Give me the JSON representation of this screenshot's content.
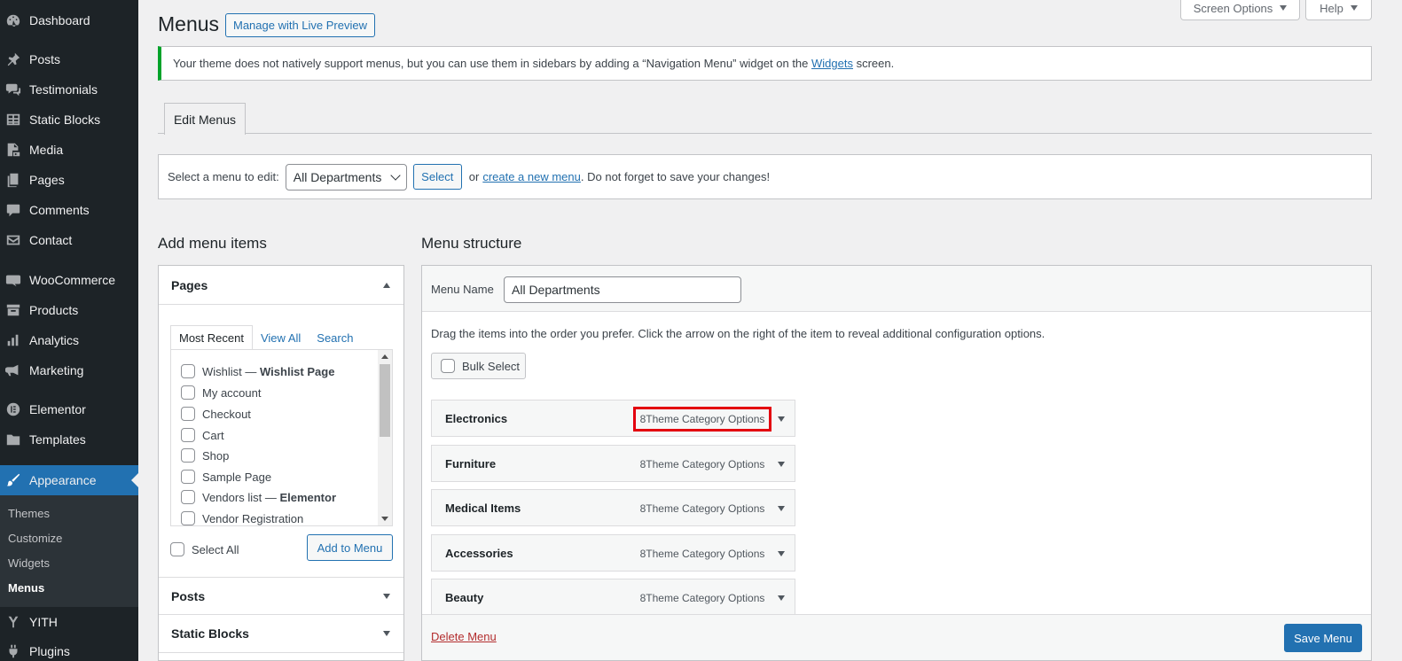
{
  "sidebar": {
    "items": [
      {
        "label": "Dashboard",
        "icon": "dashboard-icon"
      },
      {
        "label": "Posts",
        "icon": "pin-icon"
      },
      {
        "label": "Testimonials",
        "icon": "chat-bubbles-icon"
      },
      {
        "label": "Static Blocks",
        "icon": "table-icon"
      },
      {
        "label": "Media",
        "icon": "media-icon"
      },
      {
        "label": "Pages",
        "icon": "pages-icon"
      },
      {
        "label": "Comments",
        "icon": "comment-icon"
      },
      {
        "label": "Contact",
        "icon": "envelope-icon"
      },
      {
        "label": "WooCommerce",
        "icon": "woo-icon"
      },
      {
        "label": "Products",
        "icon": "archive-icon"
      },
      {
        "label": "Analytics",
        "icon": "bar-chart-icon"
      },
      {
        "label": "Marketing",
        "icon": "megaphone-icon"
      },
      {
        "label": "Elementor",
        "icon": "elementor-icon"
      },
      {
        "label": "Templates",
        "icon": "folder-icon"
      },
      {
        "label": "Appearance",
        "icon": "brush-icon"
      },
      {
        "label": "YITH",
        "icon": "yith-icon"
      },
      {
        "label": "Plugins",
        "icon": "plug-icon"
      }
    ],
    "submenu": [
      "Themes",
      "Customize",
      "Widgets",
      "Menus"
    ]
  },
  "header": {
    "title": "Menus",
    "live_preview": "Manage with Live Preview",
    "screen_options": "Screen Options",
    "help": "Help"
  },
  "notice": {
    "before": "Your theme does not natively support menus, but you can use them in sidebars by adding a “Navigation Menu” widget on the ",
    "link": "Widgets",
    "after": " screen."
  },
  "tabs": {
    "edit_menus": "Edit Menus"
  },
  "manage": {
    "label": "Select a menu to edit:",
    "selected_menu": "All Departments",
    "select_button": "Select",
    "or_text": "or",
    "create_link": "create a new menu",
    "suffix": ". Do not forget to save your changes!"
  },
  "add_items": {
    "title": "Add menu items",
    "pages_section": "Pages",
    "tabs": [
      "Most Recent",
      "View All",
      "Search"
    ],
    "pages": [
      {
        "name": "Wishlist",
        "suffix": "Wishlist Page"
      },
      {
        "name": "My account",
        "suffix": ""
      },
      {
        "name": "Checkout",
        "suffix": ""
      },
      {
        "name": "Cart",
        "suffix": ""
      },
      {
        "name": "Shop",
        "suffix": ""
      },
      {
        "name": "Sample Page",
        "suffix": ""
      },
      {
        "name": "Vendors list",
        "suffix": "Elementor"
      },
      {
        "name": "Vendor Registration",
        "suffix": ""
      }
    ],
    "separator": " — ",
    "select_all": "Select All",
    "add_button": "Add to Menu",
    "posts_section": "Posts",
    "static_blocks_section": "Static Blocks"
  },
  "structure": {
    "title": "Menu structure",
    "menu_name_label": "Menu Name",
    "menu_name_value": "All Departments",
    "instructions": "Drag the items into the order you prefer. Click the arrow on the right of the item to reveal additional configuration options.",
    "bulk_select": "Bulk Select",
    "items": [
      {
        "title": "Electronics",
        "type": "8Theme Category Options",
        "highlighted": true
      },
      {
        "title": "Furniture",
        "type": "8Theme Category Options",
        "highlighted": false
      },
      {
        "title": "Medical Items",
        "type": "8Theme Category Options",
        "highlighted": false
      },
      {
        "title": "Accessories",
        "type": "8Theme Category Options",
        "highlighted": false
      },
      {
        "title": "Beauty",
        "type": "8Theme Category Options",
        "highlighted": false
      }
    ],
    "delete_menu": "Delete Menu",
    "save_menu": "Save Menu"
  },
  "colors": {
    "admin_bg": "#1d2327",
    "accent": "#2271b1",
    "notice_border": "#00a32a",
    "highlight": "#e3000f",
    "delete": "#b32d2e"
  }
}
